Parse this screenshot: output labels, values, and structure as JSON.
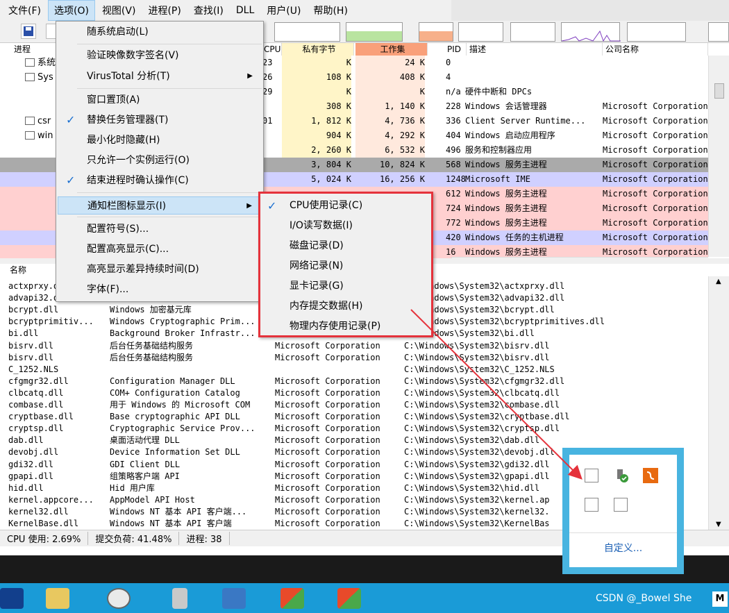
{
  "menubar": [
    "文件(F)",
    "选项(O)",
    "视图(V)",
    "进程(P)",
    "查找(I)",
    "DLL",
    "用户(U)",
    "帮助(H)"
  ],
  "options_menu": [
    {
      "label": "随系统启动(L)",
      "checked": false,
      "submenu": false,
      "highlight": false
    },
    {
      "label": "验证映像数字签名(V)",
      "checked": false,
      "submenu": false,
      "highlight": false
    },
    {
      "label": "VirusTotal 分析(T)",
      "checked": false,
      "submenu": true,
      "highlight": false
    },
    {
      "label": "窗口置顶(A)",
      "checked": false,
      "submenu": false,
      "highlight": false
    },
    {
      "label": "替换任务管理器(T)",
      "checked": true,
      "submenu": false,
      "highlight": false
    },
    {
      "label": "最小化时隐藏(H)",
      "checked": false,
      "submenu": false,
      "highlight": false
    },
    {
      "label": "只允许一个实例运行(O)",
      "checked": false,
      "submenu": false,
      "highlight": false
    },
    {
      "label": "结束进程时确认操作(C)",
      "checked": true,
      "submenu": false,
      "highlight": false
    },
    {
      "label": "通知栏图标显示(I)",
      "checked": false,
      "submenu": true,
      "highlight": true
    },
    {
      "label": "配置符号(S)...",
      "checked": false,
      "submenu": false,
      "highlight": false
    },
    {
      "label": "配置高亮显示(C)...",
      "checked": false,
      "submenu": false,
      "highlight": false
    },
    {
      "label": "高亮显示差异持续时间(D)",
      "checked": false,
      "submenu": false,
      "highlight": false
    },
    {
      "label": "字体(F)...",
      "checked": false,
      "submenu": false,
      "highlight": false
    }
  ],
  "submenu": [
    {
      "label": "CPU使用记录(C)",
      "checked": true
    },
    {
      "label": "I/O读写数据(I)",
      "checked": false
    },
    {
      "label": "磁盘记录(D)",
      "checked": false
    },
    {
      "label": "网络记录(N)",
      "checked": false
    },
    {
      "label": "显卡记录(G)",
      "checked": false
    },
    {
      "label": "内存提交数据(H)",
      "checked": false
    },
    {
      "label": "物理内存使用记录(P)",
      "checked": false
    }
  ],
  "process_headers": {
    "process": "进程",
    "cpu": "CPU",
    "private": "私有字节",
    "working": "工作集",
    "pid": "PID",
    "desc": "描述",
    "company": "公司名称"
  },
  "process_rows": [
    {
      "name": "系统",
      "cpu": "23",
      "private": "K",
      "working": "24 K",
      "pid": "0",
      "desc": "",
      "company": "",
      "color": "#ffffff"
    },
    {
      "name": "Sys",
      "cpu": "26",
      "private": "108 K",
      "working": "408 K",
      "pid": "4",
      "desc": "",
      "company": "",
      "color": "#ffffff"
    },
    {
      "name": "",
      "cpu": "29",
      "private": "K",
      "working": "K",
      "pid": "n/a",
      "desc": "硬件中断和 DPCs",
      "company": "",
      "color": "#ffffff"
    },
    {
      "name": "",
      "cpu": "",
      "private": "308 K",
      "working": "1, 140 K",
      "pid": "228",
      "desc": "Windows 会话管理器",
      "company": "Microsoft Corporation",
      "color": "#ffffff"
    },
    {
      "name": "csr",
      "cpu": "01",
      "private": "1, 812 K",
      "working": "4, 736 K",
      "pid": "336",
      "desc": "Client Server Runtime...",
      "company": "Microsoft Corporation",
      "color": "#ffffff"
    },
    {
      "name": "win",
      "cpu": "",
      "private": "904 K",
      "working": "4, 292 K",
      "pid": "404",
      "desc": "Windows 启动应用程序",
      "company": "Microsoft Corporation",
      "color": "#ffffff"
    },
    {
      "name": "",
      "cpu": "",
      "private": "2, 260 K",
      "working": "6, 532 K",
      "pid": "496",
      "desc": "服务和控制器应用",
      "company": "Microsoft Corporation",
      "color": "#ffffff"
    },
    {
      "name": "",
      "cpu": "",
      "private": "3, 804 K",
      "working": "10, 824 K",
      "pid": "568",
      "desc": "Windows 服务主进程",
      "company": "Microsoft Corporation",
      "color": "#aaaaaa"
    },
    {
      "name": "",
      "cpu": "",
      "private": "5, 024 K",
      "working": "16, 256 K",
      "pid": "1248",
      "desc": "Microsoft IME",
      "company": "Microsoft Corporation",
      "color": "#d0d0ff"
    },
    {
      "name": "",
      "cpu": "",
      "private": "",
      "working": "",
      "pid": "612",
      "desc": "Windows 服务主进程",
      "company": "Microsoft Corporation",
      "color": "#ffd0d0"
    },
    {
      "name": "",
      "cpu": "",
      "private": "",
      "working": "",
      "pid": "724",
      "desc": "Windows 服务主进程",
      "company": "Microsoft Corporation",
      "color": "#ffd0d0"
    },
    {
      "name": "",
      "cpu": "",
      "private": "",
      "working": "",
      "pid": "772",
      "desc": "Windows 服务主进程",
      "company": "Microsoft Corporation",
      "color": "#ffd0d0"
    },
    {
      "name": "",
      "cpu": "",
      "private": "",
      "working": "",
      "pid": "420",
      "desc": "Windows 任务的主机进程",
      "company": "Microsoft Corporation",
      "color": "#d0d0ff"
    },
    {
      "name": "",
      "cpu": "",
      "private": "",
      "working": "",
      "pid": "16",
      "desc": "Windows 服务主进程",
      "company": "Microsoft Corporation",
      "color": "#ffd0d0"
    }
  ],
  "dll_header": {
    "name": "名称"
  },
  "dll_rows": [
    {
      "name": "actxprxy.dll",
      "desc": "",
      "company": "",
      "path": "C:\\Windows\\System32\\actxprxy.dll"
    },
    {
      "name": "advapi32.dll",
      "desc": "",
      "company": "",
      "path": "C:\\Windows\\System32\\advapi32.dll"
    },
    {
      "name": "bcrypt.dll",
      "desc": "Windows 加密基元库",
      "company": "",
      "path": "C:\\Windows\\System32\\bcrypt.dll"
    },
    {
      "name": "bcryptprimitiv...",
      "desc": "Windows Cryptographic Prim...",
      "company": "",
      "path": "C:\\Windows\\System32\\bcryptprimitives.dll"
    },
    {
      "name": "bi.dll",
      "desc": "Background Broker Infrastr...",
      "company": "",
      "path": "C:\\Windows\\System32\\bi.dll"
    },
    {
      "name": "bisrv.dll",
      "desc": "后台任务基础结构服务",
      "company": "Microsoft Corporation",
      "path": "C:\\Windows\\System32\\bisrv.dll"
    },
    {
      "name": "bisrv.dll",
      "desc": "后台任务基础结构服务",
      "company": "Microsoft Corporation",
      "path": "C:\\Windows\\System32\\bisrv.dll"
    },
    {
      "name": "C_1252.NLS",
      "desc": "",
      "company": "",
      "path": "C:\\Windows\\System32\\C_1252.NLS"
    },
    {
      "name": "cfgmgr32.dll",
      "desc": "Configuration Manager DLL",
      "company": "Microsoft Corporation",
      "path": "C:\\Windows\\System32\\cfgmgr32.dll"
    },
    {
      "name": "clbcatq.dll",
      "desc": "COM+ Configuration Catalog",
      "company": "Microsoft Corporation",
      "path": "C:\\Windows\\System32\\clbcatq.dll"
    },
    {
      "name": "combase.dll",
      "desc": "用于 Windows 的 Microsoft COM",
      "company": "Microsoft Corporation",
      "path": "C:\\Windows\\System32\\combase.dll"
    },
    {
      "name": "cryptbase.dll",
      "desc": "Base cryptographic API DLL",
      "company": "Microsoft Corporation",
      "path": "C:\\Windows\\System32\\cryptbase.dll"
    },
    {
      "name": "cryptsp.dll",
      "desc": "Cryptographic Service Prov...",
      "company": "Microsoft Corporation",
      "path": "C:\\Windows\\System32\\cryptsp.dll"
    },
    {
      "name": "dab.dll",
      "desc": "桌面活动代理 DLL",
      "company": "Microsoft Corporation",
      "path": "C:\\Windows\\System32\\dab.dll"
    },
    {
      "name": "devobj.dll",
      "desc": "Device Information Set DLL",
      "company": "Microsoft Corporation",
      "path": "C:\\Windows\\System32\\devobj.dll"
    },
    {
      "name": "gdi32.dll",
      "desc": "GDI Client DLL",
      "company": "Microsoft Corporation",
      "path": "C:\\Windows\\System32\\gdi32.dll"
    },
    {
      "name": "gpapi.dll",
      "desc": "组策略客户端 API",
      "company": "Microsoft Corporation",
      "path": "C:\\Windows\\System32\\gpapi.dll"
    },
    {
      "name": "hid.dll",
      "desc": "Hid 用户库",
      "company": "Microsoft Corporation",
      "path": "C:\\Windows\\System32\\hid.dll"
    },
    {
      "name": "kernel.appcore...",
      "desc": "AppModel API Host",
      "company": "Microsoft Corporation",
      "path": "C:\\Windows\\System32\\kernel.ap"
    },
    {
      "name": "kernel32.dll",
      "desc": "Windows NT 基本 API 客户端...",
      "company": "Microsoft Corporation",
      "path": "C:\\Windows\\System32\\kernel32."
    },
    {
      "name": "KernelBase.dll",
      "desc": "Windows NT 基本 API 客户端",
      "company": "Microsoft Corporation",
      "path": "C:\\Windows\\System32\\KernelBas"
    }
  ],
  "status": {
    "cpu": "CPU 使用: 2.69%",
    "commit": "提交负荷: 41.48%",
    "procs": "进程: 38"
  },
  "tray": {
    "customize": "自定义..."
  },
  "watermark": "CSDN @_Bowel She",
  "colors": {
    "accent": "#1a9bd7",
    "highlight_border": "#e5323b",
    "menu_hover": "#cce4f7",
    "service_row": "#ffd0d0",
    "own_row": "#d0d0ff"
  }
}
